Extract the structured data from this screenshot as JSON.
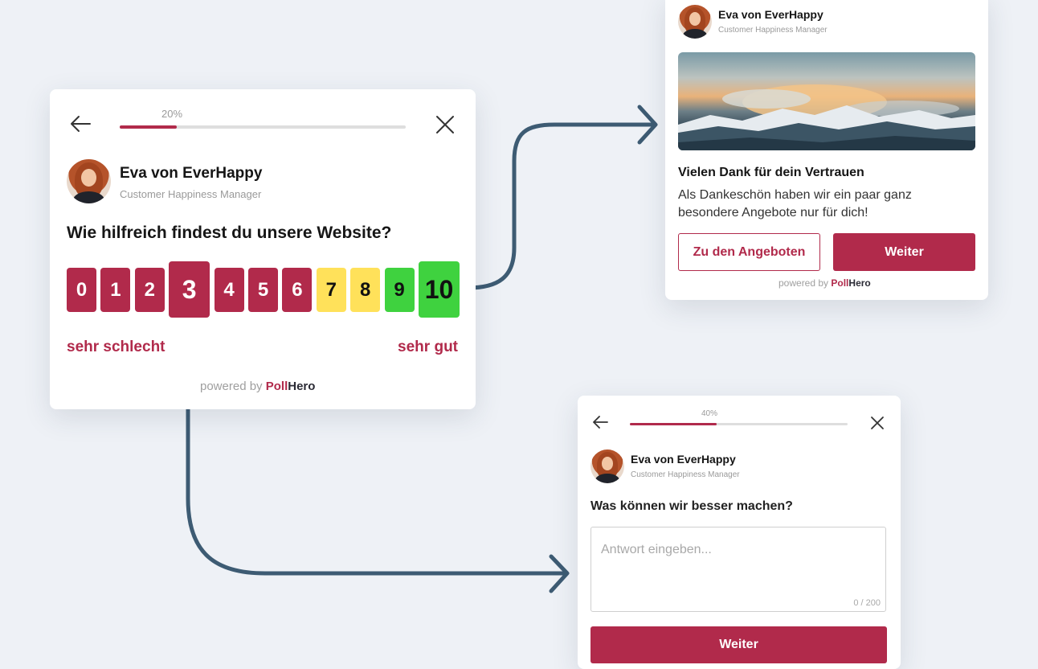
{
  "colors": {
    "brand": "#b12a4b",
    "yellow": "#ffe15a",
    "green": "#3fd23f",
    "arrow": "#3d5b73"
  },
  "main_card": {
    "progress_text": "20%",
    "progress": 0.2,
    "sender_name": "Eva von EverHappy",
    "sender_role": "Customer Happiness Manager",
    "question": "Wie hilfreich findest du unsere Website?",
    "scale": [
      {
        "label": "0",
        "color": "#b12a4b",
        "text_color": "#ffffff"
      },
      {
        "label": "1",
        "color": "#b12a4b",
        "text_color": "#ffffff"
      },
      {
        "label": "2",
        "color": "#b12a4b",
        "text_color": "#ffffff"
      },
      {
        "label": "3",
        "color": "#b12a4b",
        "text_color": "#ffffff",
        "selected": true
      },
      {
        "label": "4",
        "color": "#b12a4b",
        "text_color": "#ffffff"
      },
      {
        "label": "5",
        "color": "#b12a4b",
        "text_color": "#ffffff"
      },
      {
        "label": "6",
        "color": "#b12a4b",
        "text_color": "#ffffff"
      },
      {
        "label": "7",
        "color": "#ffe15a",
        "text_color": "#111111"
      },
      {
        "label": "8",
        "color": "#ffe15a",
        "text_color": "#111111"
      },
      {
        "label": "9",
        "color": "#3fd23f",
        "text_color": "#111111"
      },
      {
        "label": "10",
        "color": "#3fd23f",
        "text_color": "#111111",
        "selected": true
      }
    ],
    "low_label": "sehr schlecht",
    "high_label": "sehr gut",
    "powered_by": "powered by",
    "brand_a": "Poll",
    "brand_b": "Hero"
  },
  "thanks_card": {
    "sender_name": "Eva von EverHappy",
    "sender_role": "Customer Happiness Manager",
    "title": "Vielen Dank für dein Vertrauen",
    "body": "Als Dankeschön haben wir ein paar ganz besondere Angebote nur für dich!",
    "offers_button": "Zu den Angeboten",
    "next_button": "Weiter",
    "powered_by": "powered by",
    "brand_a": "Poll",
    "brand_b": "Hero"
  },
  "feedback_card": {
    "progress_text": "40%",
    "progress": 0.4,
    "sender_name": "Eva von EverHappy",
    "sender_role": "Customer Happiness Manager",
    "question": "Was können wir besser machen?",
    "placeholder": "Antwort eingeben...",
    "counter": "0 / 200",
    "next_button": "Weiter"
  }
}
